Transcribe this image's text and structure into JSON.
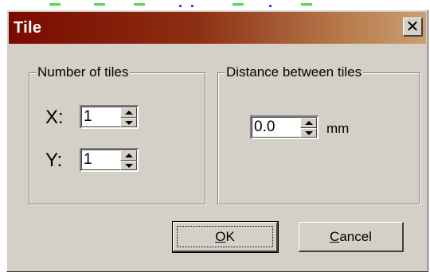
{
  "dialog": {
    "title": "Tile",
    "close_glyph": "✕"
  },
  "tiles_group": {
    "legend": "Number of tiles",
    "x": {
      "label": "X:",
      "value": "1"
    },
    "y": {
      "label": "Y:",
      "value": "1"
    }
  },
  "distance_group": {
    "legend": "Distance between tiles",
    "value": "0.0",
    "unit": "mm"
  },
  "buttons": {
    "ok": {
      "accel": "O",
      "rest": "K"
    },
    "cancel": {
      "accel": "C",
      "rest": "ancel"
    }
  },
  "colors": {
    "face": "#d4d0c8",
    "title_start": "#7a0a00",
    "title_end": "#caa070"
  }
}
